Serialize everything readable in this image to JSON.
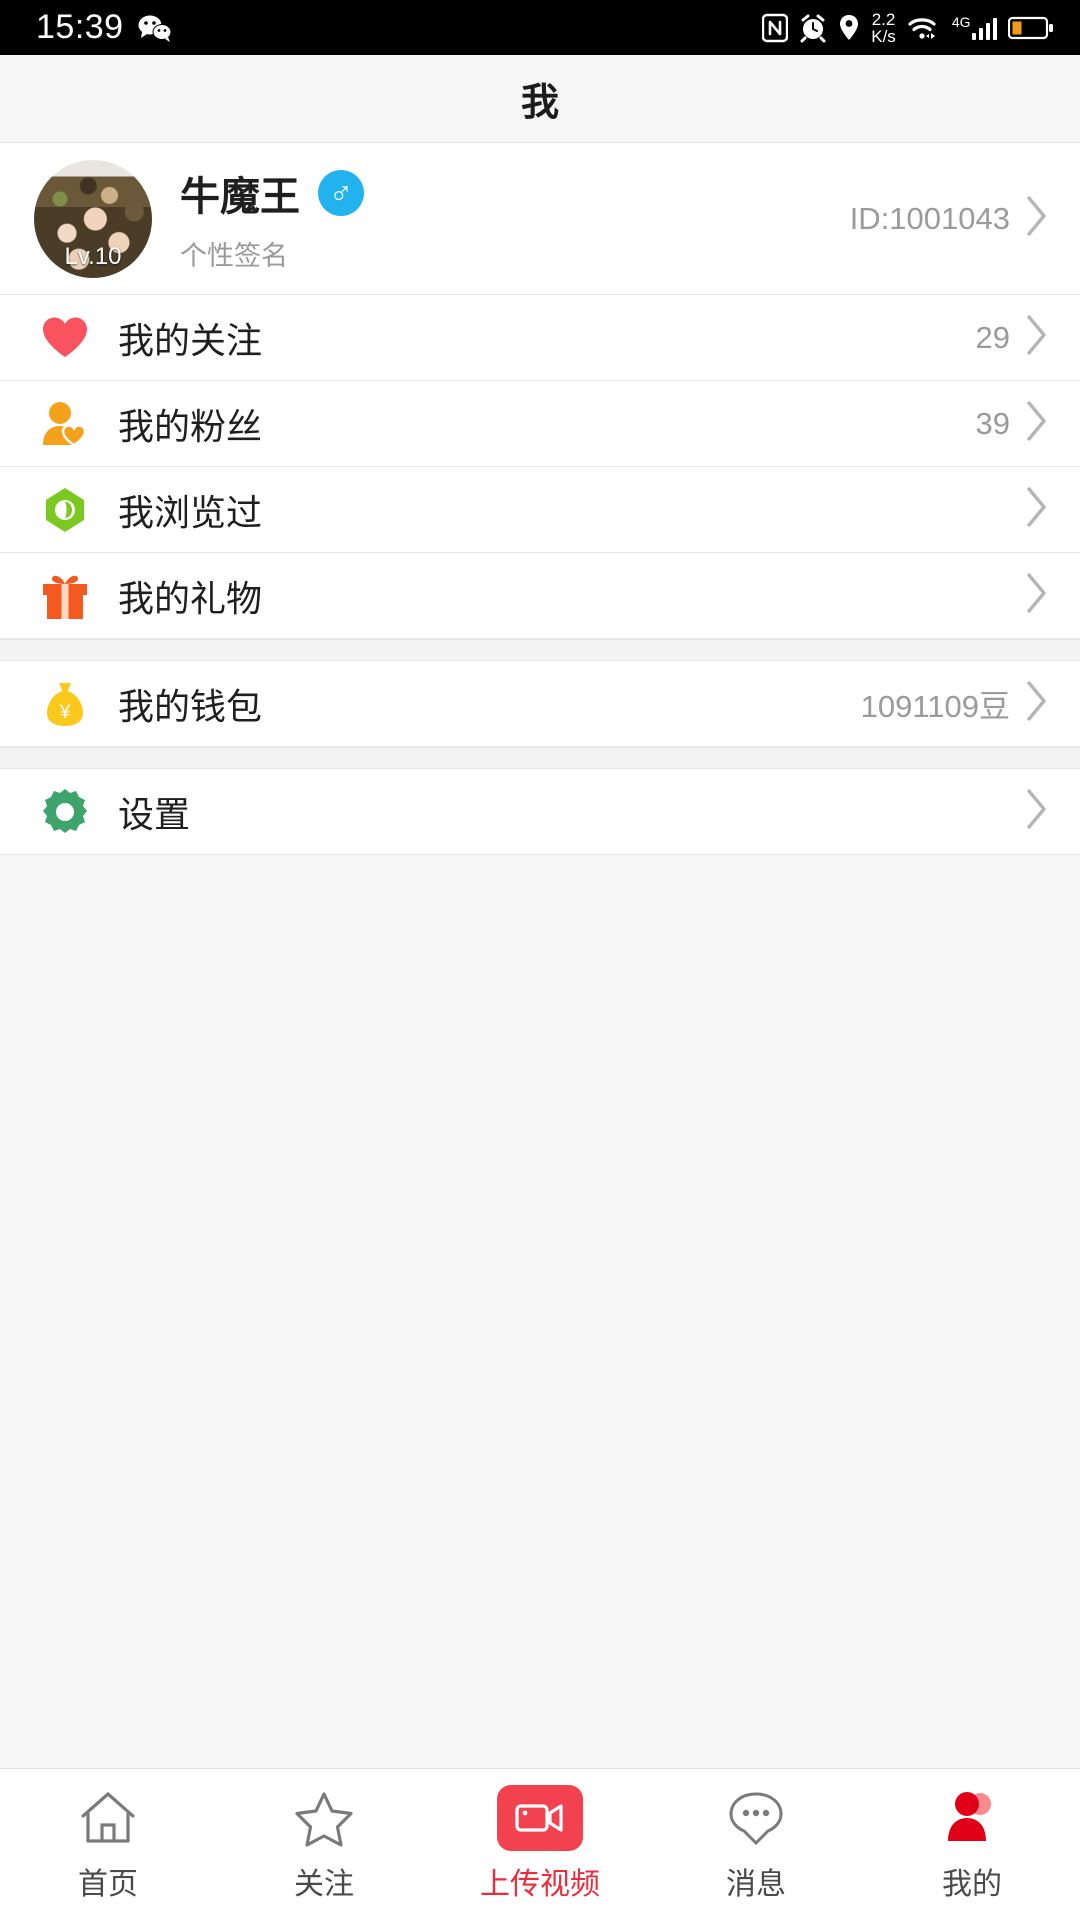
{
  "statusbar": {
    "time": "15:39",
    "wechat_icon": "wechat-icon",
    "nfc_icon": "nfc-icon",
    "alarm_icon": "alarm-icon",
    "location_icon": "location-icon",
    "net_speed_value": "2.2",
    "net_speed_unit": "K/s",
    "wifi_icon": "wifi-icon",
    "network_type": "4G",
    "signal_icon": "signal-bars-icon",
    "battery_icon": "battery-icon"
  },
  "header": {
    "title": "我"
  },
  "profile": {
    "avatar_icon": "user-avatar",
    "level_badge": "Lv.10",
    "name": "牛魔王",
    "gender_symbol": "♂",
    "signature": "个性签名",
    "id_label": "ID:1001043",
    "chevron_icon": "chevron-right-icon"
  },
  "menu": {
    "groups": [
      {
        "items": [
          {
            "icon": "heart-icon",
            "label": "我的关注",
            "value": "29",
            "color": "#f9535f"
          },
          {
            "icon": "fans-icon",
            "label": "我的粉丝",
            "value": "39",
            "color": "#f6a11b"
          },
          {
            "icon": "eye-icon",
            "label": "我浏览过",
            "value": "",
            "color": "#7ac820"
          },
          {
            "icon": "gift-icon",
            "label": "我的礼物",
            "value": "",
            "color": "#f4591f"
          }
        ]
      },
      {
        "items": [
          {
            "icon": "wallet-icon",
            "label": "我的钱包",
            "value": "1091109豆",
            "color": "#fbc91b"
          }
        ]
      },
      {
        "items": [
          {
            "icon": "gear-icon",
            "label": "设置",
            "value": "",
            "color": "#3fa36c"
          }
        ]
      }
    ]
  },
  "tabbar": {
    "items": [
      {
        "label": "首页",
        "icon": "home-icon",
        "active": false
      },
      {
        "label": "关注",
        "icon": "star-icon",
        "active": false
      },
      {
        "label": "上传视频",
        "icon": "video-upload-icon",
        "active": true
      },
      {
        "label": "消息",
        "icon": "message-icon",
        "active": false
      },
      {
        "label": "我的",
        "icon": "profile-icon",
        "active": false
      }
    ]
  },
  "colors": {
    "accent_red": "#ec2b3b",
    "upload_red": "#f2414f",
    "page_bg": "#f7f7f7",
    "card_bg": "#ffffff"
  }
}
